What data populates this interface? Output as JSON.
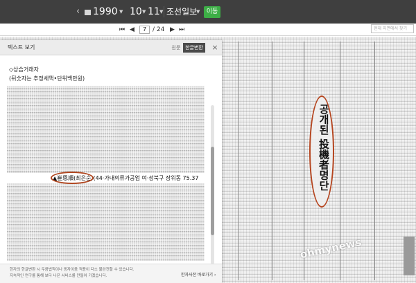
{
  "topbar": {
    "prev_label": "‹",
    "next_label": "›",
    "year": "1990",
    "month": "10",
    "day": "11",
    "newspaper": "조선일보",
    "go_button": "이동"
  },
  "pager": {
    "first": "⏮",
    "prev": "◀",
    "current_page": "7",
    "total": "/ 24",
    "next": "▶",
    "last": "⏭",
    "search_placeholder": "현재 지면에서 찾기"
  },
  "text_viewer": {
    "title": "텍스트 보기",
    "tab_original": "원문",
    "tab_converted": "한글변환",
    "close_icon": "×",
    "lines": [
      "◇상습거래자",
      "(뒤숫자는 추정세액•단위백만원)"
    ],
    "highlight_name": "▲崔恩順(최은순)",
    "highlight_rest": "(44·가내의류가공업 여·성북구 장위동 75.37",
    "footer_lines": [
      "한자의 한글변환 시 두음법칙이나 동자이음 적용이 다소 불완전할 수 있습니다.",
      "지속적인 연구를 통해 보다 나은 서비스를 만들어 가겠습니다."
    ],
    "footer_link": "한자사전 바로가기 ›"
  },
  "newspaper": {
    "headline": "공개된 投機者명단",
    "watermark": "ohmynews"
  },
  "colors": {
    "topbar": "#3f3f3f",
    "go_button": "#3dae46",
    "annotation": "#b0461f"
  }
}
